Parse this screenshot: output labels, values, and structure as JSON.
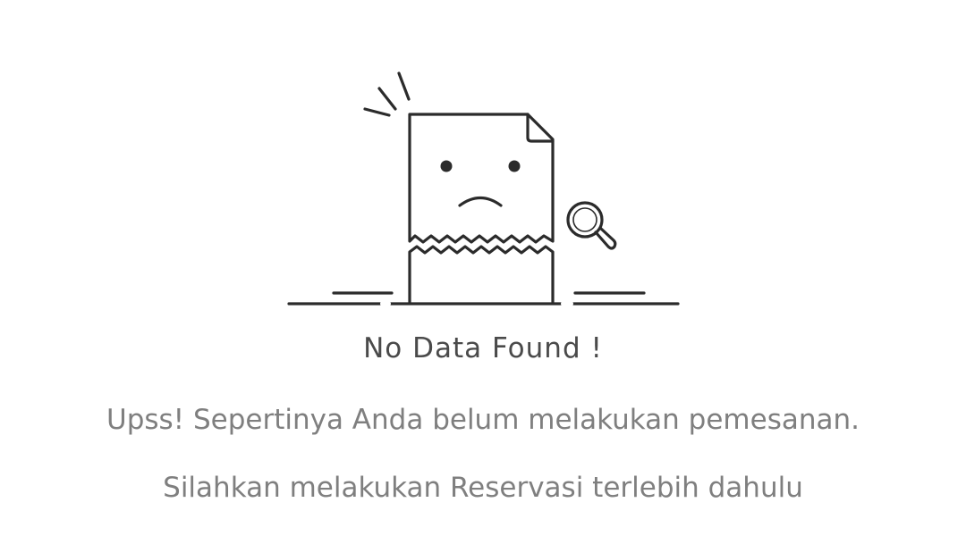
{
  "empty_state": {
    "illustration_icon": "torn-document-sad-face-icon",
    "title": "No Data Found !",
    "message_line1": "Upss! Sepertinya Anda belum melakukan pemesanan.",
    "message_line2": "Silahkan melakukan Reservasi terlebih dahulu"
  },
  "colors": {
    "background": "#ffffff",
    "title": "#4a4a4a",
    "message": "#7f7f7f",
    "illustration_stroke": "#2b2b2b"
  }
}
